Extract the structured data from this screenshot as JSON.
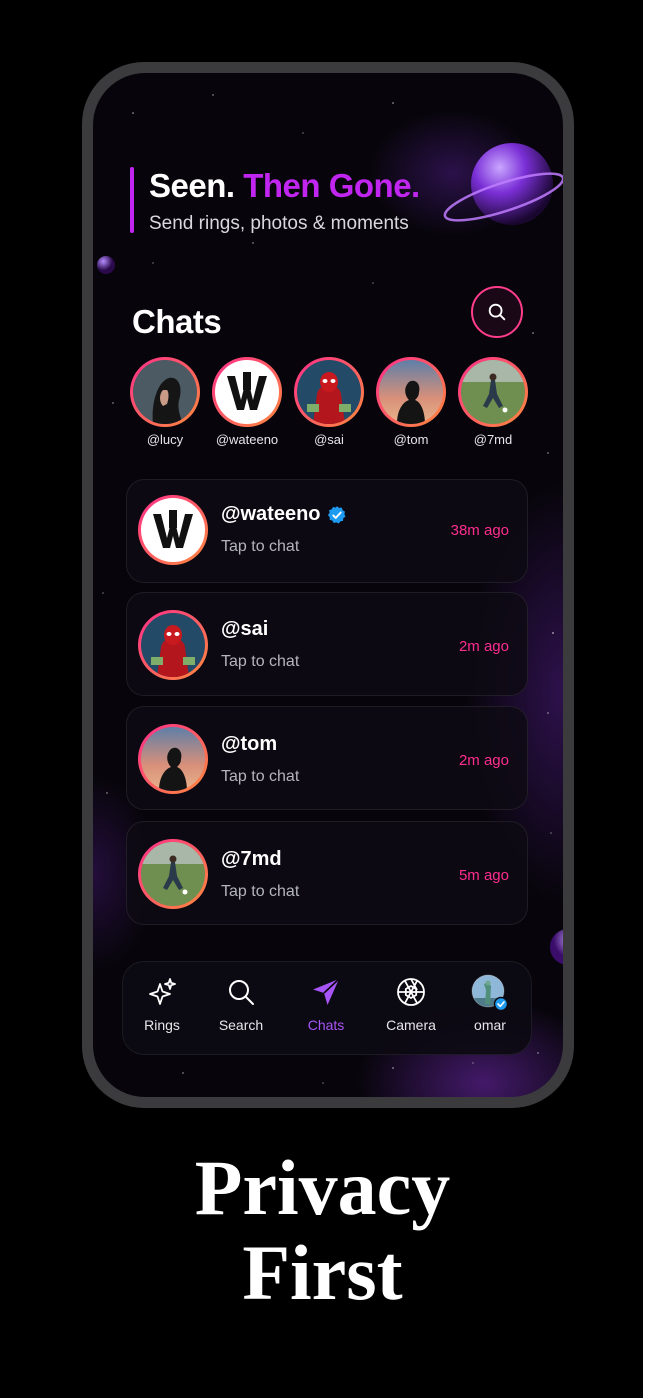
{
  "header": {
    "tagline_part1": "Seen.",
    "tagline_part2": "Then Gone.",
    "subtitle": "Send rings, photos & moments"
  },
  "main": {
    "title": "Chats",
    "search_icon": "search-icon"
  },
  "stories": [
    {
      "handle": "@lucy"
    },
    {
      "handle": "@wateeno"
    },
    {
      "handle": "@sai"
    },
    {
      "handle": "@tom"
    },
    {
      "handle": "@7md"
    }
  ],
  "chats": [
    {
      "name": "@wateeno",
      "verified": true,
      "subtitle": "Tap to chat",
      "time": "38m ago"
    },
    {
      "name": "@sai",
      "verified": false,
      "subtitle": "Tap to chat",
      "time": "2m ago"
    },
    {
      "name": "@tom",
      "verified": false,
      "subtitle": "Tap to chat",
      "time": "2m ago"
    },
    {
      "name": "@7md",
      "verified": false,
      "subtitle": "Tap to chat",
      "time": "5m ago"
    }
  ],
  "tabbar": {
    "tabs": [
      {
        "label": "Rings",
        "icon": "sparkle-icon"
      },
      {
        "label": "Search",
        "icon": "search-icon"
      },
      {
        "label": "Chats",
        "icon": "send-icon",
        "active": true
      },
      {
        "label": "Camera",
        "icon": "aperture-icon"
      },
      {
        "label": "omar",
        "icon": "profile-avatar"
      }
    ]
  },
  "caption": {
    "line1": "Privacy",
    "line2": "First"
  },
  "colors": {
    "accent_purple": "#c026f0",
    "accent_pink": "#ff2d8e",
    "active_tab": "#a855f7",
    "verified_blue": "#1d9bf0"
  }
}
